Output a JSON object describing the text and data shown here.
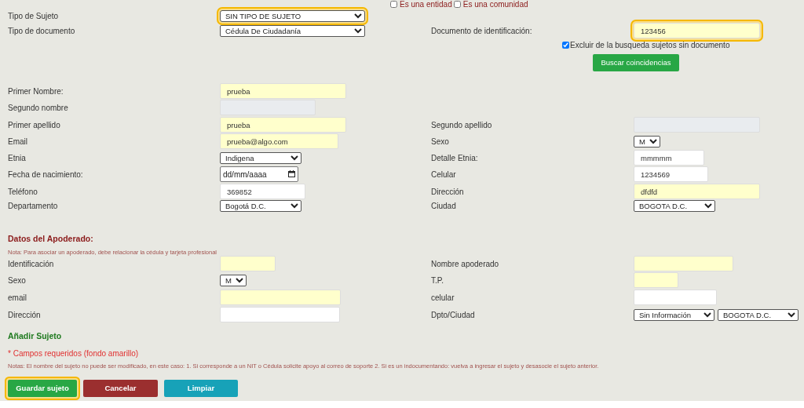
{
  "top_checkboxes": [
    {
      "label": "Es una entidad",
      "checked": false
    },
    {
      "label": "Es una comunidad",
      "checked": false
    }
  ],
  "rows": [
    {
      "kind": "fields",
      "cells": [
        {
          "label": "Tipo de Sujeto",
          "fields": [
            {
              "kind": "select",
              "value": "SIN TIPO DE SUJETO",
              "highlighted": true
            }
          ]
        }
      ]
    },
    {
      "kind": "fields",
      "cells": [
        {
          "label": "Tipo de documento",
          "fields": [
            {
              "kind": "select",
              "value": "Cédula De Ciudadanía",
              "highlighted": false
            }
          ]
        },
        {
          "label": "Documento de identificación:",
          "fields": [
            {
              "kind": "text",
              "value": "123456",
              "required": true,
              "disabled": false,
              "highlighted": true
            }
          ]
        }
      ]
    },
    {
      "kind": "checkbox",
      "label": "Excluir de la busqueda sujetos sin documento",
      "checked": true
    },
    {
      "kind": "button",
      "label": "Buscar coincidencias"
    },
    {
      "kind": "fields",
      "cells": [
        {
          "label": "Primer Nombre:",
          "fields": [
            {
              "kind": "text",
              "value": "prueba",
              "required": true,
              "disabled": false,
              "highlighted": false
            }
          ]
        }
      ]
    },
    {
      "kind": "fields",
      "cells": [
        {
          "label": "Segundo nombre",
          "fields": [
            {
              "kind": "text",
              "disabled": true,
              "highlighted": false
            }
          ]
        }
      ]
    },
    {
      "kind": "fields",
      "cells": [
        {
          "label": "Primer apellido",
          "fields": [
            {
              "kind": "text",
              "value": "prueba",
              "required": true,
              "disabled": false,
              "highlighted": false
            }
          ]
        },
        {
          "label": "Segundo apellido",
          "fields": [
            {
              "kind": "text",
              "disabled": true,
              "highlighted": false
            }
          ]
        }
      ]
    },
    {
      "kind": "fields",
      "cells": [
        {
          "label": "Email",
          "fields": [
            {
              "kind": "text",
              "value": "prueba@algo.com",
              "required": true,
              "disabled": false,
              "highlighted": false
            }
          ]
        },
        {
          "label": "Sexo",
          "fields": [
            {
              "kind": "select",
              "value": "M",
              "highlighted": false
            }
          ]
        }
      ]
    },
    {
      "kind": "fields",
      "cells": [
        {
          "label": "Etnia",
          "fields": [
            {
              "kind": "select",
              "value": "Indigena",
              "highlighted": false
            }
          ]
        },
        {
          "label": "Detalle Etnia:",
          "fields": [
            {
              "kind": "text",
              "value": "mmmmm",
              "required": false,
              "disabled": false,
              "highlighted": false
            }
          ]
        }
      ]
    },
    {
      "kind": "fields",
      "cells": [
        {
          "label": "Fecha de nacimiento:",
          "fields": [
            {
              "kind": "date",
              "placeholder": "dd/mm/aaaa",
              "highlighted": false
            }
          ]
        },
        {
          "label": "Celular",
          "fields": [
            {
              "kind": "text",
              "value": "1234569",
              "required": false,
              "disabled": false,
              "highlighted": false
            }
          ]
        }
      ]
    },
    {
      "kind": "fields",
      "cells": [
        {
          "label": "Teléfono",
          "fields": [
            {
              "kind": "text",
              "value": "369852",
              "required": false,
              "disabled": false,
              "highlighted": false
            }
          ]
        },
        {
          "label": "Dirección",
          "fields": [
            {
              "kind": "text",
              "value": "dfdfd",
              "required": true,
              "disabled": false,
              "highlighted": false
            }
          ]
        }
      ]
    },
    {
      "kind": "fields",
      "cells": [
        {
          "label": "Departamento",
          "fields": [
            {
              "kind": "select",
              "value": "Bogotá D.C.",
              "highlighted": false
            }
          ]
        },
        {
          "label": "Ciudad",
          "fields": [
            {
              "kind": "select",
              "value": "BOGOTA D.C.",
              "highlighted": false
            }
          ]
        }
      ]
    }
  ],
  "apoderado": {
    "title": "Datos del Apoderado:",
    "note": "Nota: Para asociar un apoderado, debe relacionar la cédula y tarjeta profesional",
    "rows": [
      {
        "kind": "fields",
        "cells": [
          {
            "label": "Identificación",
            "fields": [
              {
                "kind": "text",
                "required": true,
                "disabled": false,
                "highlighted": false
              }
            ]
          },
          {
            "label": "Nombre apoderado",
            "fields": [
              {
                "kind": "text",
                "required": true,
                "disabled": false,
                "highlighted": false
              }
            ]
          }
        ]
      },
      {
        "kind": "fields",
        "cells": [
          {
            "label": "Sexo",
            "fields": [
              {
                "kind": "select",
                "value": "M",
                "highlighted": false
              }
            ]
          },
          {
            "label": "T.P.",
            "fields": [
              {
                "kind": "text",
                "required": true,
                "disabled": false,
                "highlighted": false
              }
            ]
          }
        ]
      },
      {
        "kind": "fields",
        "cells": [
          {
            "label": "email",
            "fields": [
              {
                "kind": "text",
                "required": true,
                "disabled": false,
                "highlighted": false
              }
            ]
          },
          {
            "label": "celular",
            "fields": [
              {
                "kind": "text",
                "required": false,
                "disabled": false,
                "highlighted": false
              }
            ]
          }
        ]
      },
      {
        "kind": "fields",
        "cells": [
          {
            "label": "Dirección",
            "fields": [
              {
                "kind": "text",
                "required": false,
                "disabled": false,
                "highlighted": false
              }
            ]
          },
          {
            "label": "Dpto/Ciudad",
            "fields": [
              {
                "kind": "select",
                "value": "Sin Información",
                "highlighted": false
              },
              {
                "kind": "select",
                "value": "BOGOTA D.C.",
                "highlighted": false
              }
            ]
          }
        ]
      }
    ]
  },
  "add_subject": {
    "title": "Añadir Sujeto",
    "required_note": "* Campos requeridos (fondo amarillo)",
    "notes": "Notas: El nombre del sujeto no puede ser modificado, en este caso: 1. Si corresponde a un NIT o Cédula solicite apoyo al correo de soporte 2. Si es un indocumentando: vuelva a ingresar el sujeto y desasocie el sujeto anterior."
  },
  "buttons": [
    {
      "kind": "save",
      "label": "Guardar sujeto",
      "highlighted": true
    },
    {
      "kind": "cancel",
      "label": "Cancelar",
      "highlighted": false
    },
    {
      "kind": "clear",
      "label": "Limpiar",
      "highlighted": false
    }
  ]
}
